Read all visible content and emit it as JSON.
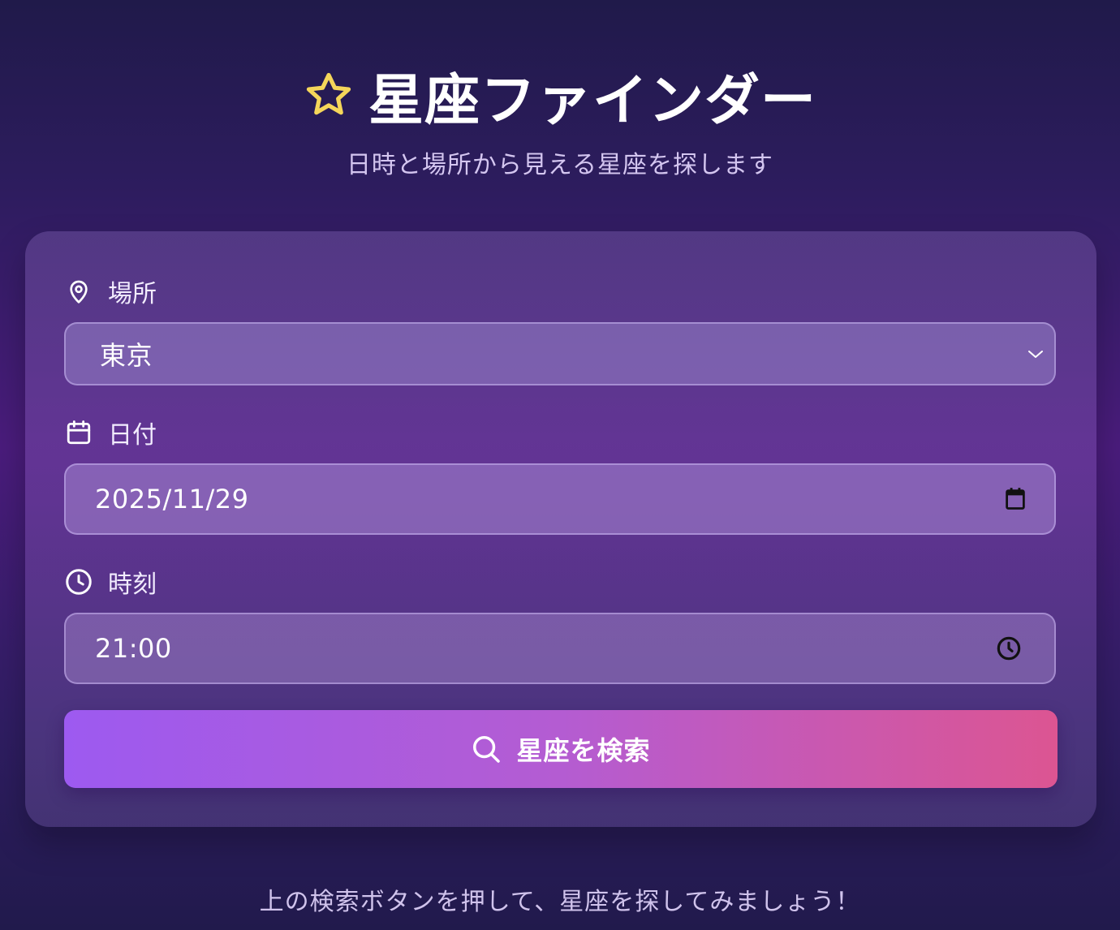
{
  "header": {
    "title": "星座ファインダー",
    "subtitle": "日時と場所から見える星座を探します",
    "title_icon": "star-outline-icon",
    "title_icon_color": "#f5d65a"
  },
  "form": {
    "location": {
      "label": "場所",
      "icon": "map-pin-icon",
      "value": "東京",
      "dropdown_icon": "chevron-down-icon"
    },
    "date": {
      "label": "日付",
      "icon": "calendar-icon",
      "value": "2025/11/29",
      "picker_icon": "calendar-filled-icon"
    },
    "time": {
      "label": "時刻",
      "icon": "clock-icon",
      "value": "21:00",
      "picker_icon": "clock-icon"
    },
    "search_button": {
      "label": "星座を検索",
      "icon": "search-icon",
      "gradient_start": "#9d5af0",
      "gradient_end": "#dc5592"
    }
  },
  "footer": {
    "hint": "上の検索ボタンを押して、星座を探してみましょう！"
  },
  "colors": {
    "background_top": "#201a4a",
    "background_mid": "#4a1c7c",
    "subtitle_text": "#d4c6f0"
  }
}
